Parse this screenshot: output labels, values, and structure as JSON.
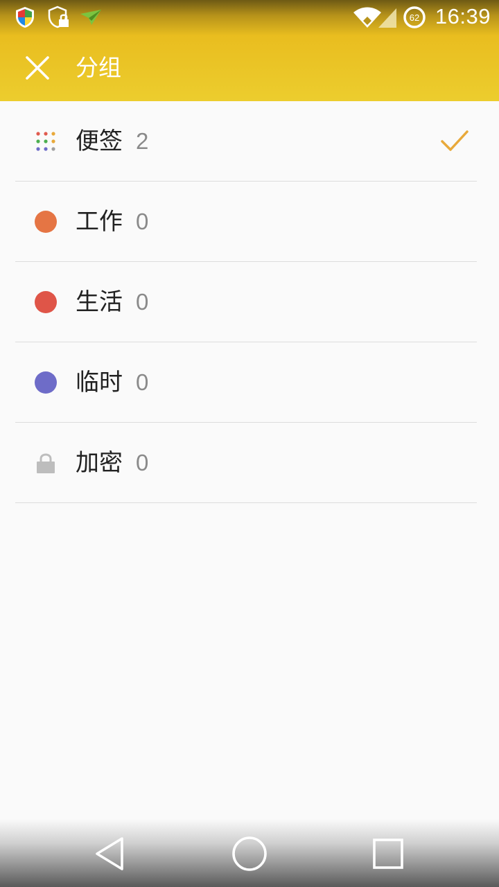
{
  "status_bar": {
    "time": "16:39",
    "battery_level": "62",
    "icons": [
      "shield-app-icon",
      "shield-lock-icon",
      "paper-plane-icon",
      "wifi-icon",
      "cell-signal-icon",
      "battery-ring-icon"
    ]
  },
  "app_bar": {
    "title": "分组",
    "close_icon": "close-icon",
    "color": "#e9bd1f"
  },
  "groups": [
    {
      "label": "便签",
      "count": "2",
      "icon": "grid-dots-icon",
      "selected": true
    },
    {
      "label": "工作",
      "count": "0",
      "icon": "color-dot-icon",
      "color": "#e57544"
    },
    {
      "label": "生活",
      "count": "0",
      "icon": "color-dot-icon",
      "color": "#df5548"
    },
    {
      "label": "临时",
      "count": "0",
      "icon": "color-dot-icon",
      "color": "#6e6cc8"
    },
    {
      "label": "加密",
      "count": "0",
      "icon": "lock-icon",
      "color": "#bdbdbd"
    }
  ],
  "check_color": "#e8a93a",
  "nav_bar": {
    "icons": [
      "back-icon",
      "home-icon",
      "recents-icon"
    ]
  }
}
